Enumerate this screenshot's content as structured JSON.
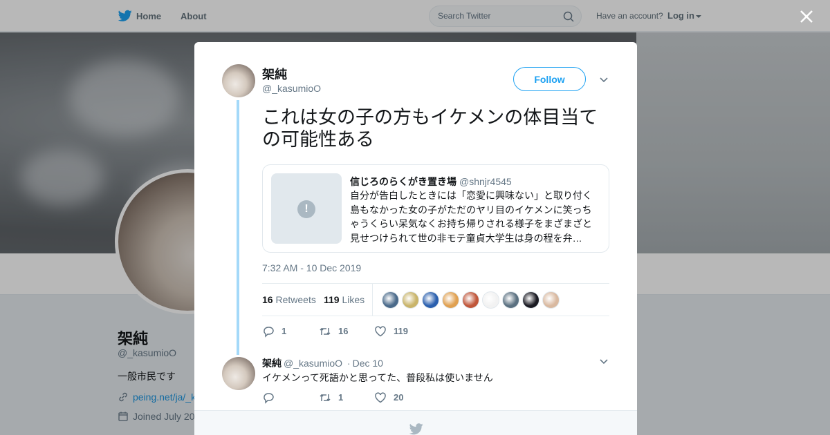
{
  "nav": {
    "home": "Home",
    "about": "About",
    "search_placeholder": "Search Twitter",
    "have_account": "Have an account?",
    "login": "Log in"
  },
  "profile": {
    "name": "架純",
    "handle": "@_kasumioO",
    "bio": "一般市民です",
    "link": "peing.net/ja/_k",
    "joined": "Joined July 20"
  },
  "tweet": {
    "author_name": "架純",
    "author_handle": "@_kasumioO",
    "follow_label": "Follow",
    "text": "これは女の子の方もイケメンの体目当ての可能性ある",
    "quote": {
      "name": "信じろのらくがき置き場",
      "handle": "@shnjr4545",
      "text": "自分が告白したときには「恋愛に興味ない」と取り付く島もなかった女の子がただのヤリ目のイケメンに笑っちゃうくらい呆気なくお持ち帰りされる様子をまざまざと見せつけられて世の非モテ童貞大学生は身の程を弁…",
      "placeholder_icon": "!"
    },
    "timestamp": "7:32 AM - 10 Dec 2019",
    "retweets_count": "16",
    "retweets_label": "Retweets",
    "likes_count": "119",
    "likes_label": "Likes",
    "liker_colors": [
      "#4a6a8a",
      "#c9b46a",
      "#2a5fae",
      "#e0a050",
      "#c0563a",
      "#f2f2f2",
      "#5a7080",
      "#1a1a22",
      "#d9b9a0"
    ],
    "actions": {
      "replies": "1",
      "retweets": "16",
      "likes": "119"
    }
  },
  "reply": {
    "name": "架純",
    "handle": "@_kasumioO",
    "separator": "·",
    "date": "Dec 10",
    "text": "イケメンって死語かと思ってた、普段私は使いません",
    "actions": {
      "replies": "",
      "retweets": "1",
      "likes": "20"
    }
  },
  "colors": {
    "brand": "#1da1f2",
    "thread_line": "#a4d9f9"
  }
}
